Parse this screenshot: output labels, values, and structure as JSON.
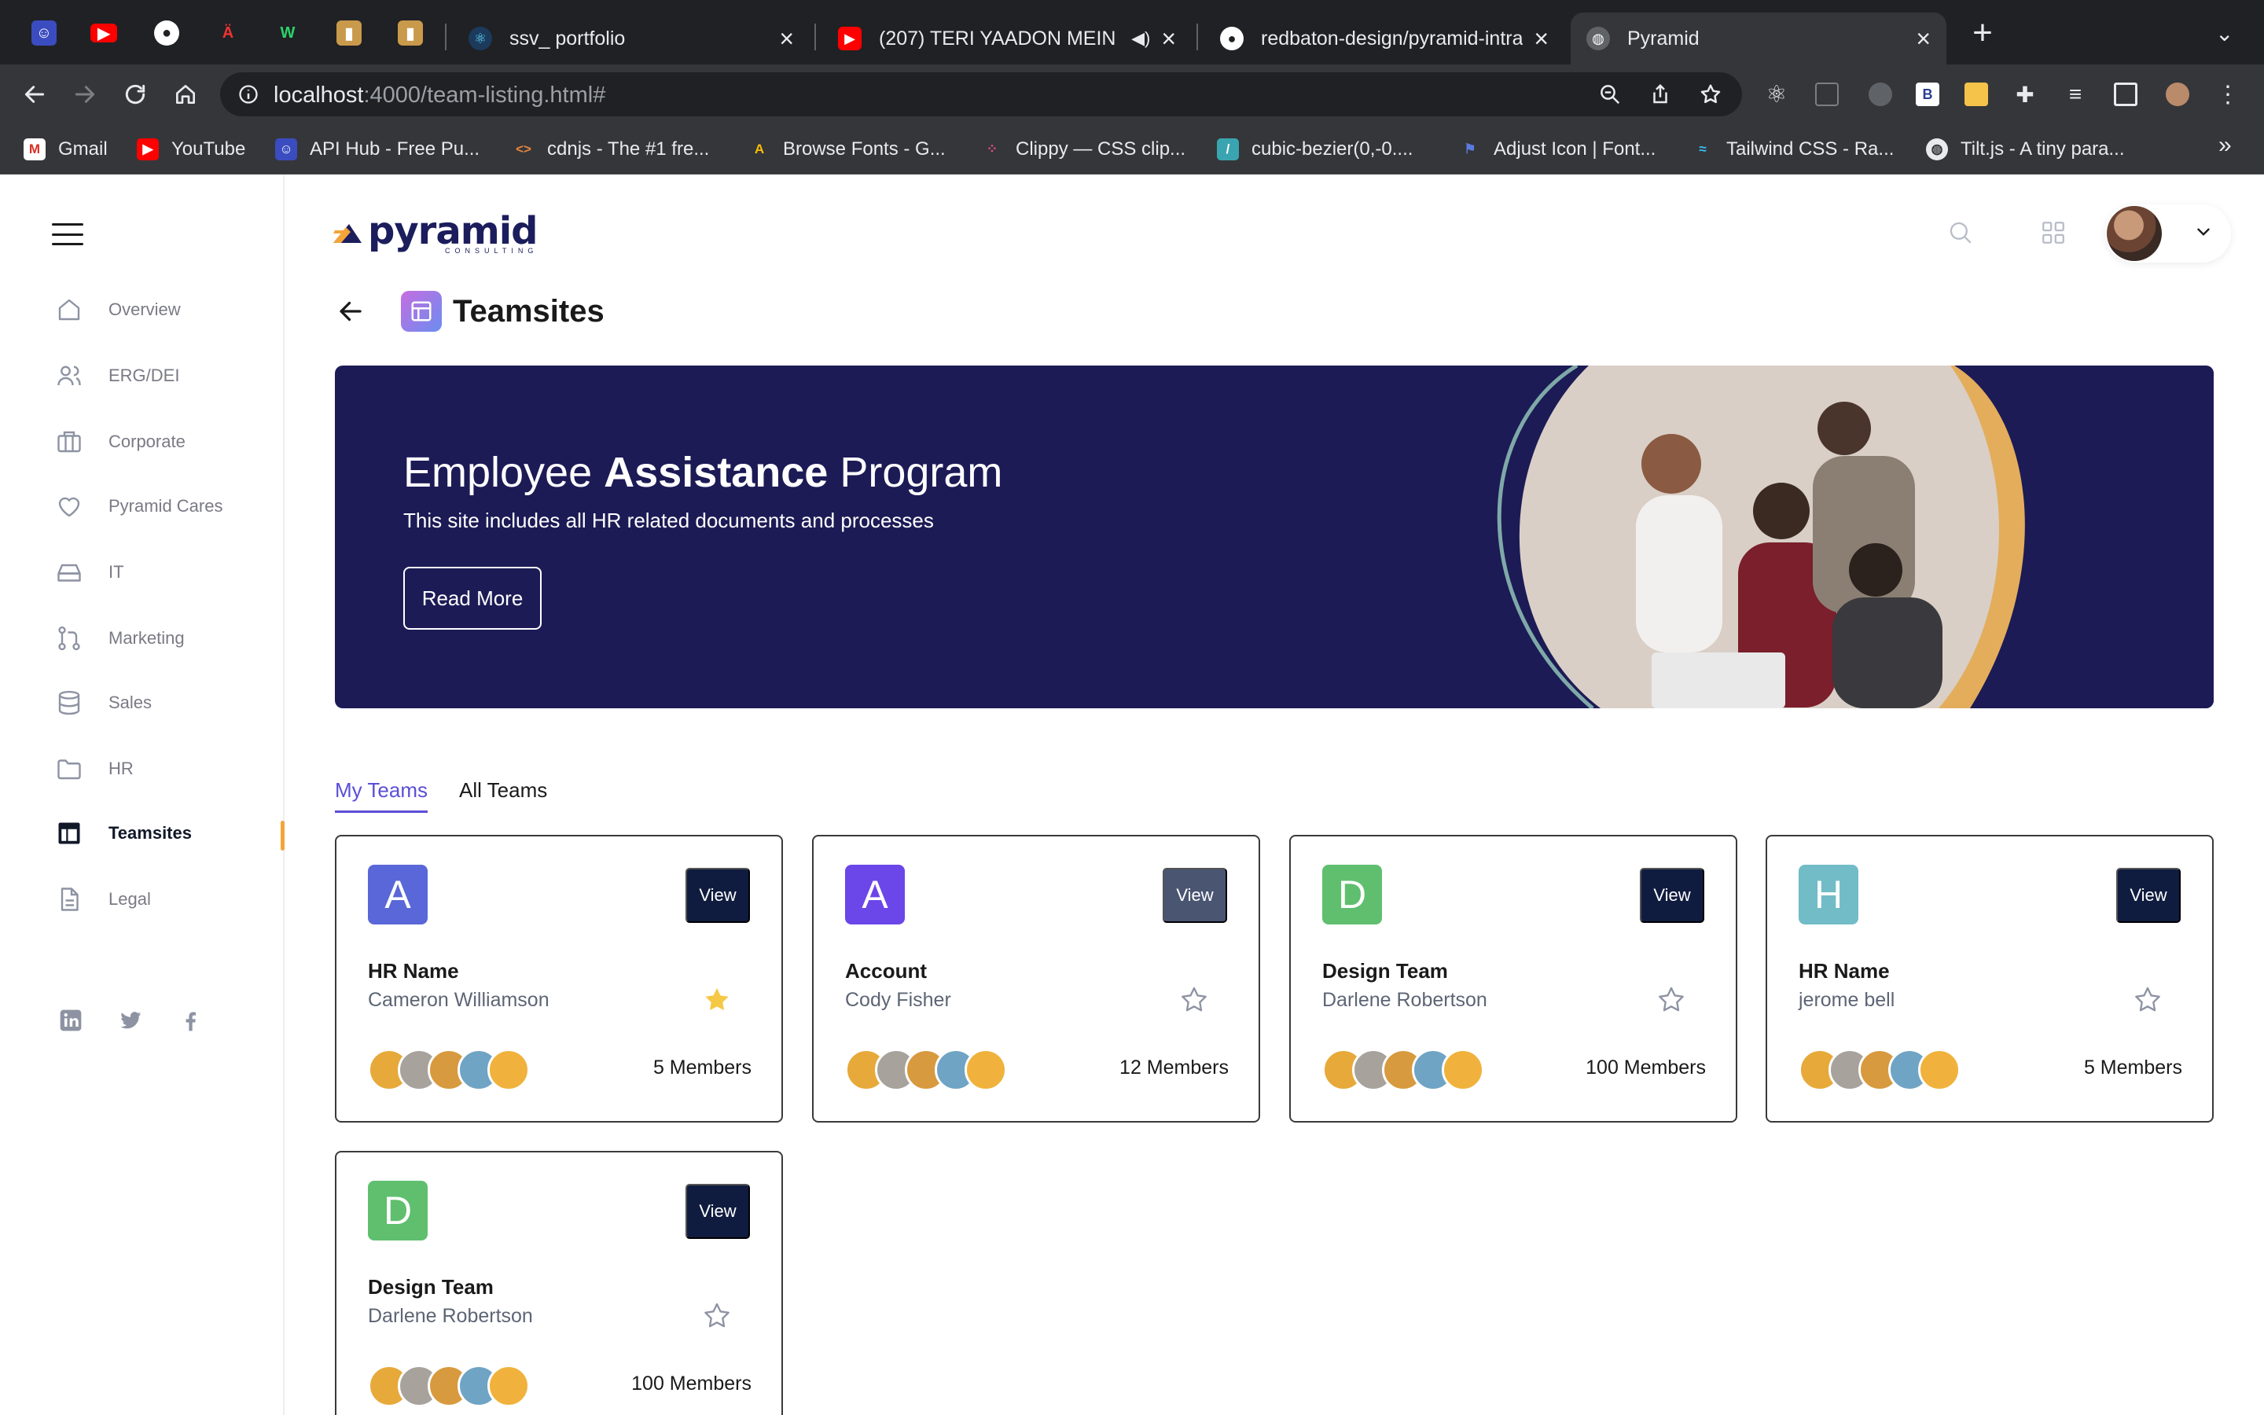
{
  "browser": {
    "tabs": [
      {
        "title": "ssv_ portfolio",
        "close": "×"
      },
      {
        "title": "(207) TERI YAADON MEIN",
        "close": "×"
      },
      {
        "title": "redbaton-design/pyramid-intra",
        "close": "×"
      },
      {
        "title": "Pyramid",
        "close": "×",
        "active": true
      }
    ],
    "new_tab": "+",
    "url_host": "localhost",
    "url_path": ":4000/team-listing.html#",
    "bookmarks": [
      {
        "label": "Gmail",
        "icon": "gmail-icon"
      },
      {
        "label": "YouTube",
        "icon": "youtube-icon"
      },
      {
        "label": "API Hub - Free Pu...",
        "icon": "api-hub-icon"
      },
      {
        "label": "cdnjs - The #1 fre...",
        "icon": "code-icon"
      },
      {
        "label": "Browse Fonts - G...",
        "icon": "google-fonts-icon"
      },
      {
        "label": "Clippy — CSS clip...",
        "icon": "clippy-icon"
      },
      {
        "label": "cubic-bezier(0,-0....",
        "icon": "cubic-bezier-icon"
      },
      {
        "label": "Adjust Icon | Font...",
        "icon": "flag-icon"
      },
      {
        "label": "Tailwind CSS - Ra...",
        "icon": "tailwind-icon"
      },
      {
        "label": "Tilt.js - A tiny para...",
        "icon": "globe-icon"
      }
    ],
    "bookmarks_more": "»"
  },
  "sidebar": {
    "items": [
      {
        "label": "Overview",
        "icon": "home-icon"
      },
      {
        "label": "ERG/DEI",
        "icon": "users-icon"
      },
      {
        "label": "Corporate",
        "icon": "briefcase-icon"
      },
      {
        "label": "Pyramid Cares",
        "icon": "heart-icon"
      },
      {
        "label": "IT",
        "icon": "hard-drive-icon"
      },
      {
        "label": "Marketing",
        "icon": "git-pull-request-icon"
      },
      {
        "label": "Sales",
        "icon": "database-icon"
      },
      {
        "label": "HR",
        "icon": "folder-icon"
      },
      {
        "label": "Teamsites",
        "icon": "layout-icon",
        "active": true
      },
      {
        "label": "Legal",
        "icon": "file-text-icon"
      }
    ]
  },
  "header": {
    "logo_text": "pyramid",
    "logo_sub": "CONSULTING"
  },
  "page": {
    "title": "Teamsites"
  },
  "banner": {
    "title_pre": "Employee ",
    "title_bold": "Assistance",
    "title_post": " Program",
    "subtitle": "This site includes all HR related documents and processes",
    "button": "Read More"
  },
  "tabs": {
    "my_teams": "My Teams",
    "all_teams": "All Teams"
  },
  "cards": [
    {
      "letter": "A",
      "letter_color": "#5a67d8",
      "name": "HR Name",
      "owner": "Cameron Williamson",
      "members": "5 Members",
      "favorite": true,
      "view": "View"
    },
    {
      "letter": "A",
      "letter_color": "#6b46e8",
      "name": "Account",
      "owner": "Cody Fisher",
      "members": "12 Members",
      "favorite": false,
      "view": "View"
    },
    {
      "letter": "D",
      "letter_color": "#5fbf6e",
      "name": "Design Team",
      "owner": "Darlene Robertson",
      "members": "100 Members",
      "favorite": false,
      "view": "View"
    },
    {
      "letter": "H",
      "letter_color": "#72bcc7",
      "name": "HR Name",
      "owner": "jerome bell",
      "members": "5 Members",
      "favorite": false,
      "view": "View"
    },
    {
      "letter": "D",
      "letter_color": "#5fbf6e",
      "name": "Design Team",
      "owner": "Darlene Robertson",
      "members": "100 Members",
      "favorite": false,
      "view": "View"
    }
  ],
  "colors": {
    "accent": "#5b4fd6",
    "active_marker": "#f3a53a",
    "banner_bg": "#1c1b56",
    "view_button": "#101c3f",
    "star_filled": "#f5c845"
  }
}
